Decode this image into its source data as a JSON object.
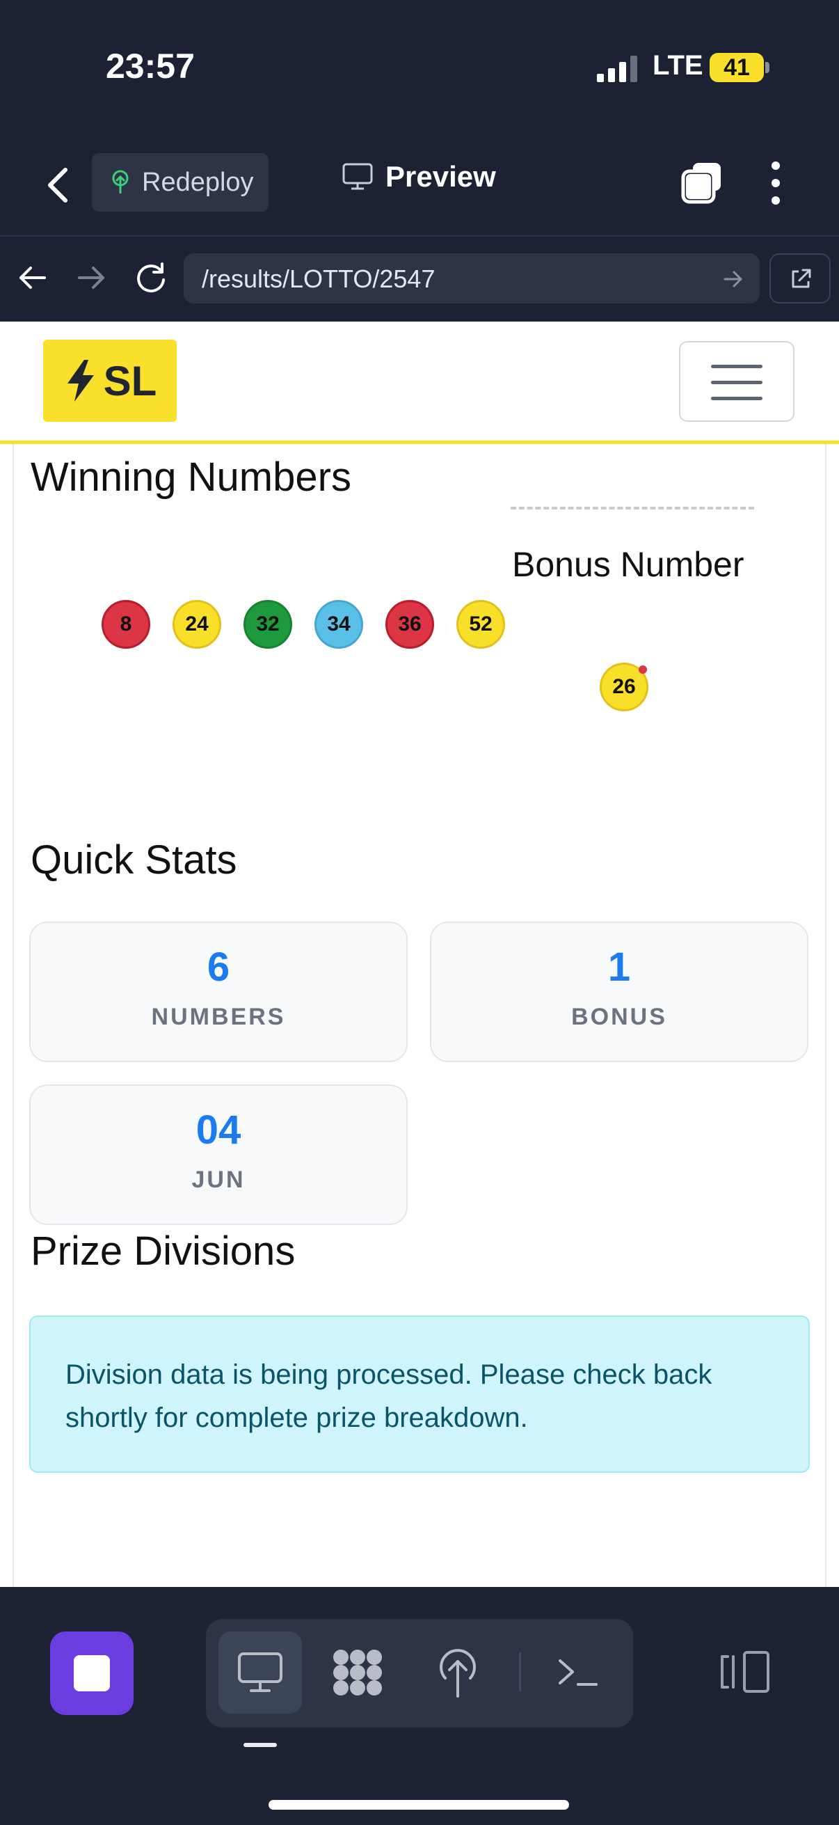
{
  "status_bar": {
    "time": "23:57",
    "network": "LTE",
    "battery": "41"
  },
  "app_header": {
    "redeploy_label": "Redeploy",
    "preview_label": "Preview"
  },
  "browser": {
    "url": "/results/LOTTO/2547"
  },
  "site": {
    "logo_text": "SL"
  },
  "winning": {
    "heading": "Winning Numbers",
    "numbers": [
      {
        "value": "8",
        "color": "red"
      },
      {
        "value": "24",
        "color": "yellow"
      },
      {
        "value": "32",
        "color": "green"
      },
      {
        "value": "34",
        "color": "blue"
      },
      {
        "value": "36",
        "color": "red"
      },
      {
        "value": "52",
        "color": "yellow"
      }
    ],
    "bonus_label": "Bonus Number",
    "bonus_number": "26"
  },
  "quick_stats": {
    "heading": "Quick Stats",
    "items": [
      {
        "value": "6",
        "label": "NUMBERS"
      },
      {
        "value": "1",
        "label": "BONUS"
      },
      {
        "value": "04",
        "label": "JUN"
      }
    ]
  },
  "prize_divisions": {
    "heading": "Prize Divisions",
    "message": "Division data is being processed. Please check back shortly for complete prize breakdown."
  },
  "colors": {
    "accent_yellow": "#fbe02b",
    "stat_blue": "#1a7cf0",
    "stop_purple": "#6b3de0"
  }
}
